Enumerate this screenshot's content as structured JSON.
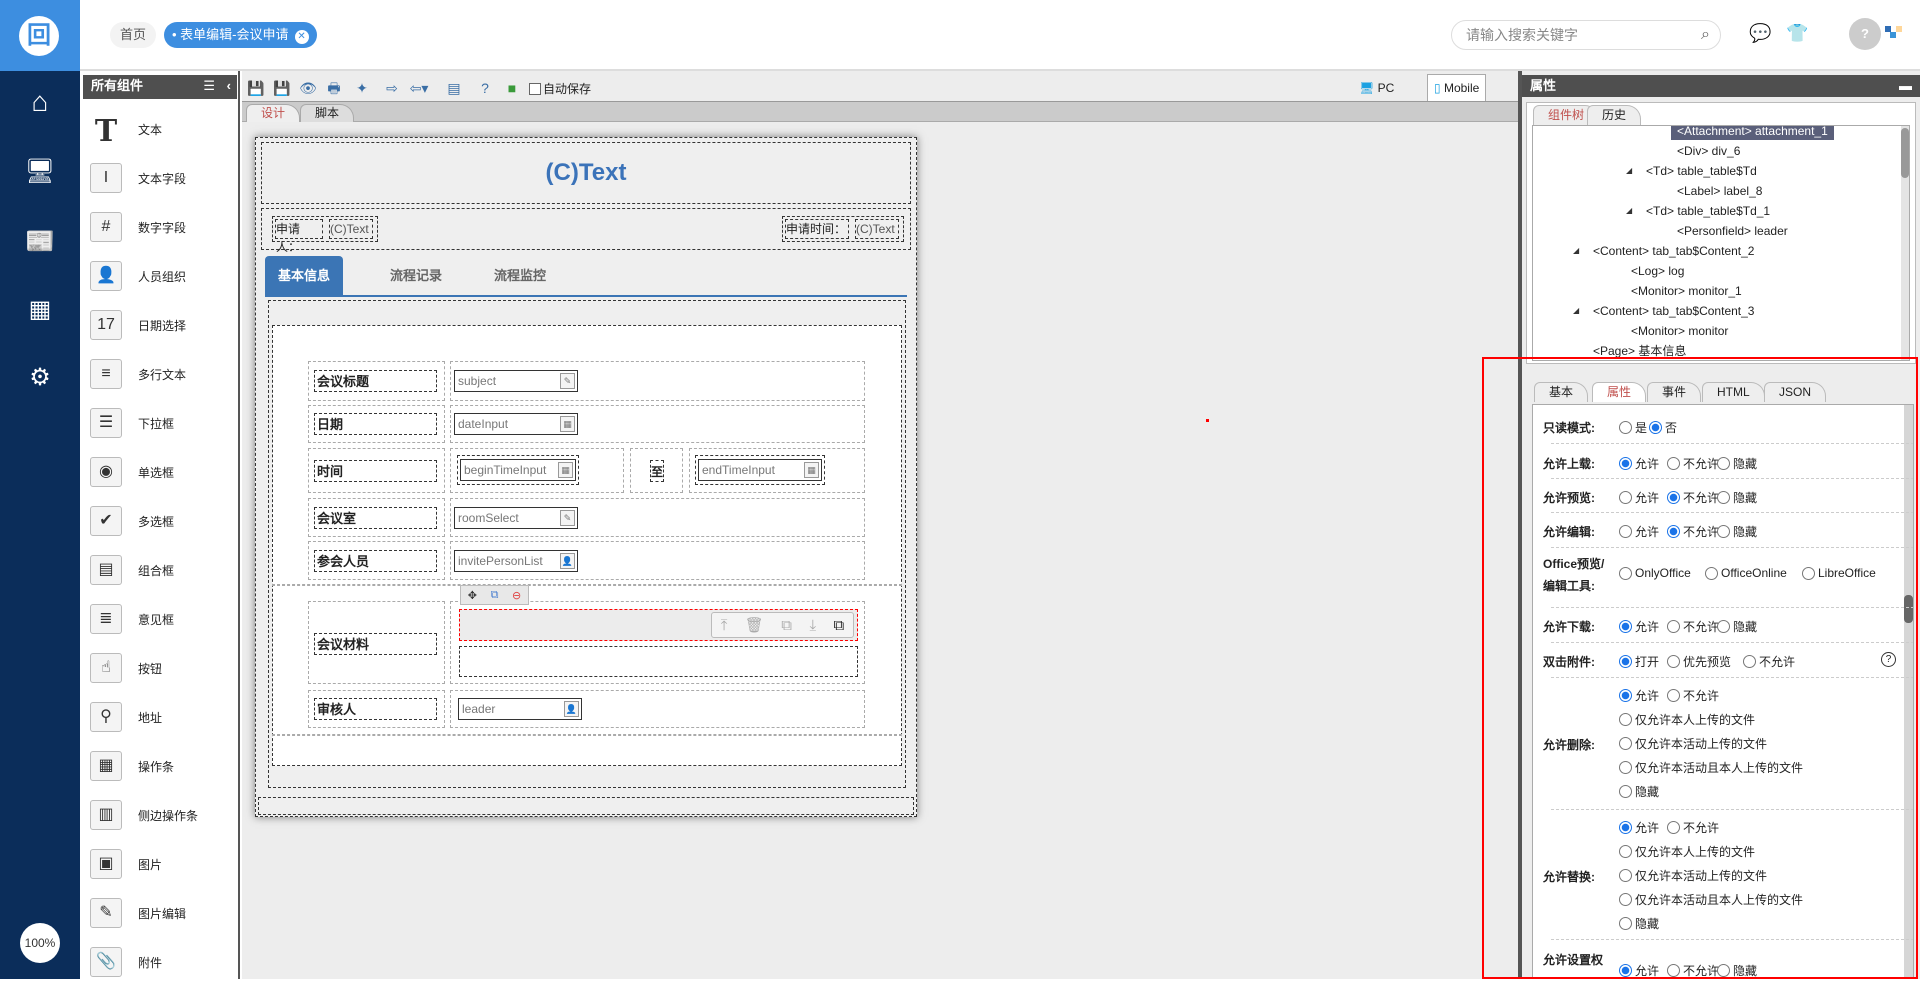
{
  "nav": {
    "logo": "回",
    "zoom": "100%",
    "items": [
      "home",
      "monitor-user",
      "news",
      "calendar",
      "user-settings"
    ]
  },
  "header": {
    "home_tab": "首页",
    "active_tab": "表单编辑-会议申请",
    "search_placeholder": "请输入搜索关键字"
  },
  "palette": {
    "title": "所有组件",
    "items": [
      {
        "label": "文本",
        "icon": "T"
      },
      {
        "label": "文本字段",
        "icon": "I"
      },
      {
        "label": "数字字段",
        "icon": "#"
      },
      {
        "label": "人员组织",
        "icon": "👤"
      },
      {
        "label": "日期选择",
        "icon": "17"
      },
      {
        "label": "多行文本",
        "icon": "≡"
      },
      {
        "label": "下拉框",
        "icon": "☰"
      },
      {
        "label": "单选框",
        "icon": "◉"
      },
      {
        "label": "多选框",
        "icon": "✔"
      },
      {
        "label": "组合框",
        "icon": "▤"
      },
      {
        "label": "意见框",
        "icon": "≣"
      },
      {
        "label": "按钮",
        "icon": "☝"
      },
      {
        "label": "地址",
        "icon": "⚲"
      },
      {
        "label": "操作条",
        "icon": "▦"
      },
      {
        "label": "侧边操作条",
        "icon": "▥"
      },
      {
        "label": "图片",
        "icon": "▣"
      },
      {
        "label": "图片编辑",
        "icon": "✎"
      },
      {
        "label": "附件",
        "icon": "📎"
      }
    ]
  },
  "toolbar": {
    "autosave": "自动保存",
    "pc": "PC",
    "mobile": "Mobile",
    "tabs": [
      "设计",
      "脚本"
    ]
  },
  "form": {
    "title": "(C)Text",
    "applicant_label": "申请人：",
    "applicant_value": "(C)Text",
    "time_label": "申请时间：",
    "time_value": "(C)Text",
    "tabs": [
      "基本信息",
      "流程记录",
      "流程监控"
    ],
    "rows": {
      "subject_label": "会议标题",
      "subject": "subject",
      "date_label": "日期",
      "date": "dateInput",
      "time_label": "时间",
      "begin": "beginTimeInput",
      "to": "至",
      "end": "endTimeInput",
      "room_label": "会议室",
      "room": "roomSelect",
      "invite_label": "参会人员",
      "invite": "invitePersonList",
      "material_label": "会议材料",
      "leader_label": "审核人",
      "leader": "leader"
    }
  },
  "right": {
    "title": "属性",
    "tree_tabs": [
      "组件树",
      "历史"
    ],
    "tree": [
      "<Attachment> attachment_1",
      "<Div> div_6",
      "<Td> table_table$Td",
      "<Label> label_8",
      "<Td> table_table$Td_1",
      "<Personfield> leader",
      "<Content> tab_tab$Content_2",
      "<Log> log",
      "<Monitor> monitor_1",
      "<Content> tab_tab$Content_3",
      "<Monitor> monitor",
      "<Page> 基本信息"
    ],
    "prop_tabs": [
      "基本",
      "属性",
      "事件",
      "HTML",
      "JSON"
    ],
    "props": {
      "readonly": {
        "label": "只读模式:",
        "options": [
          "是",
          "否"
        ],
        "selected": 1
      },
      "upload": {
        "label": "允许上载:",
        "options": [
          "允许",
          "不允许",
          "隐藏"
        ],
        "selected": 0
      },
      "preview": {
        "label": "允许预览:",
        "options": [
          "允许",
          "不允许",
          "隐藏"
        ],
        "selected": 1
      },
      "edit": {
        "label": "允许编辑:",
        "options": [
          "允许",
          "不允许",
          "隐藏"
        ],
        "selected": 1
      },
      "office": {
        "label1": "Office预览/",
        "label2": "编辑工具:",
        "options": [
          "OnlyOffice",
          "OfficeOnline",
          "LibreOffice"
        ],
        "selected": -1
      },
      "download": {
        "label": "允许下载:",
        "options": [
          "允许",
          "不允许",
          "隐藏"
        ],
        "selected": 0
      },
      "dblclick": {
        "label": "双击附件:",
        "options": [
          "打开",
          "优先预览",
          "不允许"
        ],
        "selected": 0,
        "help": "?"
      },
      "delete": {
        "label": "允许删除:",
        "options": [
          "允许",
          "不允许",
          "仅允许本人上传的文件",
          "仅允许本活动上传的文件",
          "仅允许本活动且本人上传的文件",
          "隐藏"
        ],
        "selected": 0
      },
      "replace": {
        "label": "允许替换:",
        "options": [
          "允许",
          "不允许",
          "仅允许本人上传的文件",
          "仅允许本活动上传的文件",
          "仅允许本活动且本人上传的文件",
          "隐藏"
        ],
        "selected": 0
      },
      "perm": {
        "label": "允许设置权",
        "options": [
          "允许",
          "不允许",
          "隐藏"
        ],
        "selected": 0
      }
    }
  },
  "colors": {
    "nav": "#0b2d5a",
    "accent": "#3d8ee0",
    "form_blue": "#3b75b5",
    "highlight": "#f00"
  }
}
